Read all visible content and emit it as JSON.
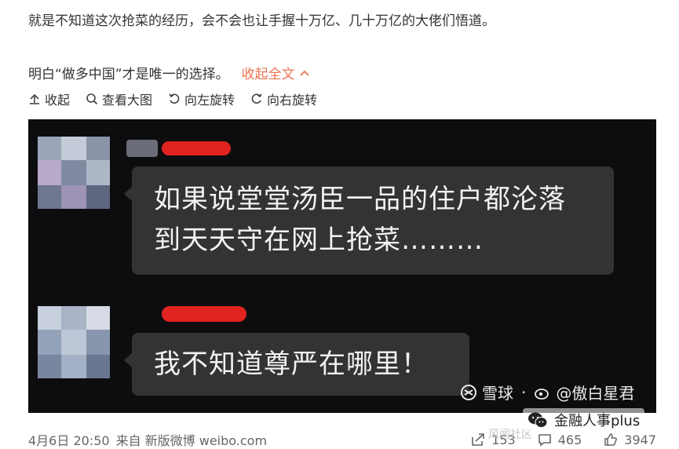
{
  "post": {
    "line1": "就是不知道这次抢菜的经历，会不会也让手握十万亿、几十万亿的大佬们悟道。",
    "line2": "明白“做多中国”才是唯一的选择。",
    "collapse_label": "收起全文"
  },
  "toolbar": {
    "collapse": "收起",
    "view_large": "查看大图",
    "rotate_left": "向左旋转",
    "rotate_right": "向右旋转"
  },
  "image": {
    "message1_line1": "如果说堂堂汤臣一品的住户都沦落",
    "message1_line2": "到天天守在网上抢菜………",
    "message2": "我不知道尊严在哪里！",
    "watermark_brand": "雪球",
    "watermark_user": "@傲白星君"
  },
  "footer": {
    "time": "4月6日 20:50",
    "source": "来自 新版微博 weibo.com",
    "reposts": "153",
    "comments": "465",
    "likes": "3947"
  },
  "overlay": {
    "account": "金融人事plus",
    "faint": "风闻社区"
  },
  "colors": {
    "accent": "#eb7350",
    "image_bg": "#0d0d0f",
    "bubble": "#333335",
    "redaction": "#e0231f"
  }
}
